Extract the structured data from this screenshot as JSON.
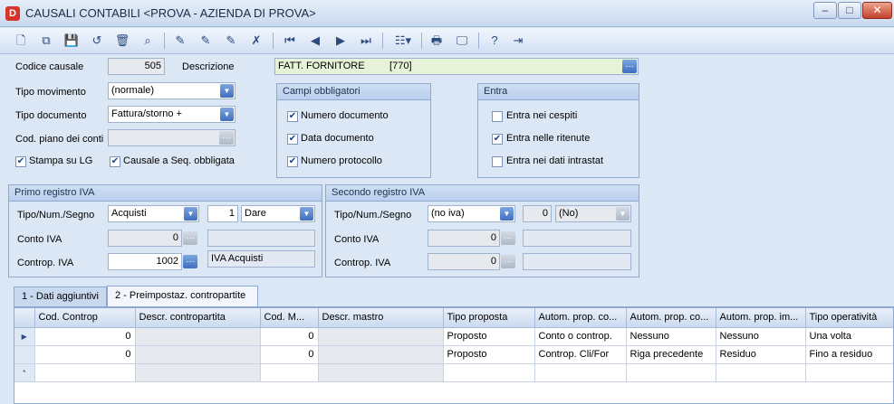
{
  "window": {
    "title": "CAUSALI CONTABILI <PROVA - AZIENDA DI PROVA>"
  },
  "fields": {
    "codice_causale_label": "Codice causale",
    "codice_causale": "505",
    "descrizione_label": "Descrizione",
    "descrizione": "FATT. FORNITORE         [770]",
    "tipo_movimento_label": "Tipo movimento",
    "tipo_movimento": "(normale)",
    "tipo_documento_label": "Tipo documento",
    "tipo_documento": "Fattura/storno +",
    "cod_piano_label": "Cod. piano dei conti",
    "cod_piano": "",
    "stampa_lg_label": "Stampa  su LG",
    "stampa_lg_checked": true,
    "causale_seq_label": "Causale a Seq. obbligata",
    "causale_seq_checked": true
  },
  "campi_obbligatori": {
    "title": "Campi obbligatori",
    "items": [
      {
        "label": "Numero documento",
        "checked": true
      },
      {
        "label": "Data documento",
        "checked": true
      },
      {
        "label": "Numero protocollo",
        "checked": true
      }
    ]
  },
  "entra": {
    "title": "Entra",
    "items": [
      {
        "label": "Entra nei cespiti",
        "checked": false
      },
      {
        "label": "Entra nelle ritenute",
        "checked": true
      },
      {
        "label": "Entra nei dati intrastat",
        "checked": false
      }
    ]
  },
  "primo_registro": {
    "title": "Primo registro IVA",
    "tipo_label": "Tipo/Num./Segno",
    "tipo": "Acquisti",
    "num": "1",
    "segno": "Dare",
    "conto_label": "Conto IVA",
    "conto": "0",
    "conto_desc": "",
    "controp_label": "Controp. IVA",
    "controp": "1002",
    "controp_desc": "IVA Acquisti"
  },
  "secondo_registro": {
    "title": "Secondo registro IVA",
    "tipo_label": "Tipo/Num./Segno",
    "tipo": "(no iva)",
    "num": "0",
    "segno": "(No)",
    "conto_label": "Conto IVA",
    "conto": "0",
    "controp_label": "Controp. IVA",
    "controp": "0"
  },
  "tabs": [
    {
      "label": "1 - Dati aggiuntivi",
      "active": false
    },
    {
      "label": "2 - Preimpostaz. contropartite",
      "active": true
    }
  ],
  "grid": {
    "columns": [
      "Cod. Controp",
      "Descr. contropartita",
      "Cod. M...",
      "Descr. mastro",
      "Tipo proposta",
      "Autom. prop. co...",
      "Autom. prop. co...",
      "Autom. prop. im...",
      "Tipo operatività"
    ],
    "rows": [
      [
        "0",
        "",
        "0",
        "",
        "Proposto",
        "Conto o controp.",
        "Nessuno",
        "Nessuno",
        "Una volta"
      ],
      [
        "0",
        "",
        "0",
        "",
        "Proposto",
        "Controp. Cli/For",
        "Riga precedente",
        "Residuo",
        "Fino a residuo"
      ]
    ],
    "new_row_marker": "*",
    "current_row_marker": "▶"
  },
  "colors": {
    "accent": "#3d6fc0",
    "panel": "#dce7f5",
    "readonly": "#e6e9ee",
    "description_bg": "#e7f3d8"
  }
}
